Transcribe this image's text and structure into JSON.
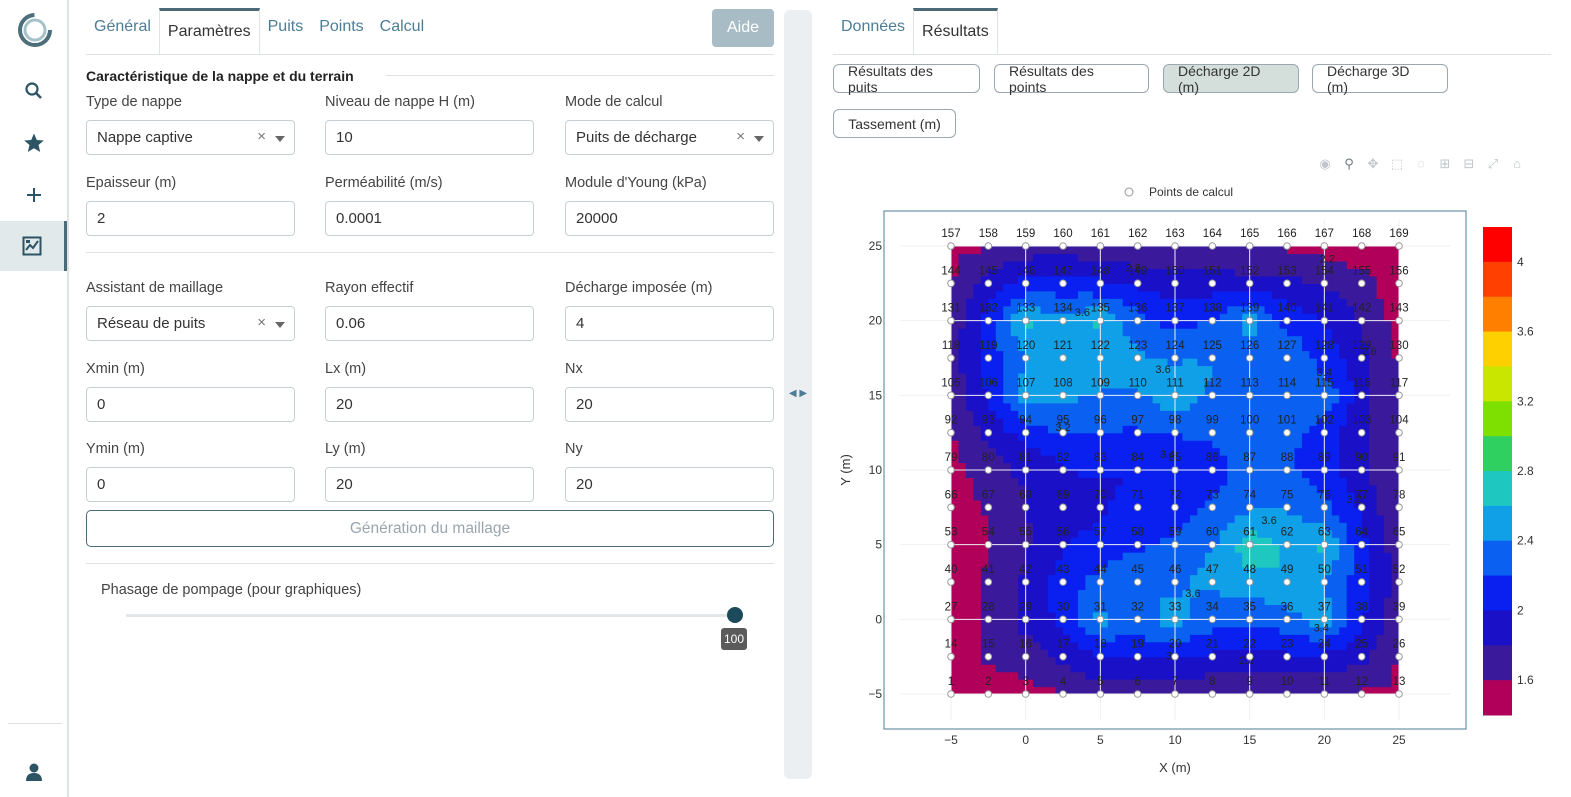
{
  "sidebar": {
    "items": [
      {
        "name": "search-icon"
      },
      {
        "name": "star-icon"
      },
      {
        "name": "plus-icon"
      },
      {
        "name": "chart-icon"
      }
    ]
  },
  "left_tabs": [
    "Général",
    "Paramètres",
    "Puits",
    "Points",
    "Calcul"
  ],
  "left_tabs_active": "Paramètres",
  "help_label": "Aide",
  "section_title": "Caractéristique de la nappe et du terrain",
  "fields": {
    "type_nappe": {
      "label": "Type de nappe",
      "value": "Nappe captive"
    },
    "niveau_nappe": {
      "label": "Niveau de nappe H (m)",
      "value": "10"
    },
    "mode_calcul": {
      "label": "Mode de calcul",
      "value": "Puits de décharge"
    },
    "epaisseur": {
      "label": "Epaisseur (m)",
      "value": "2"
    },
    "permeabilite": {
      "label": "Perméabilité (m/s)",
      "value": "0.0001"
    },
    "module_young": {
      "label": "Module d'Young (kPa)",
      "value": "20000"
    },
    "assistant": {
      "label": "Assistant de maillage",
      "value": "Réseau de puits"
    },
    "rayon": {
      "label": "Rayon effectif",
      "value": "0.06"
    },
    "decharge": {
      "label": "Décharge imposée (m)",
      "value": "4"
    },
    "xmin": {
      "label": "Xmin (m)",
      "value": "0"
    },
    "lx": {
      "label": "Lx (m)",
      "value": "20"
    },
    "nx": {
      "label": "Nx",
      "value": "20"
    },
    "ymin": {
      "label": "Ymin (m)",
      "value": "0"
    },
    "ly": {
      "label": "Ly (m)",
      "value": "20"
    },
    "ny": {
      "label": "Ny",
      "value": "20"
    }
  },
  "clear_symbol": "×",
  "generate_label": "Génération du maillage",
  "slider": {
    "label": "Phasage de pompage (pour graphiques)",
    "value": "100",
    "fraction": 1.0
  },
  "right_tabs": [
    "Données",
    "Résultats"
  ],
  "right_tabs_active": "Résultats",
  "result_buttons": [
    "Résultats des puits",
    "Résultats des points",
    "Décharge 2D (m)",
    "Décharge 3D (m)",
    "Tassement (m)"
  ],
  "result_active": "Décharge 2D (m)",
  "chart_data": {
    "type": "contour",
    "legend_label": "Points de calcul",
    "xlabel": "X (m)",
    "ylabel": "Y (m)",
    "xlim": [
      -5,
      25
    ],
    "ylim": [
      -5,
      25
    ],
    "xticks": [
      "−5",
      "0",
      "5",
      "10",
      "15",
      "20",
      "25"
    ],
    "yticks": [
      "−5",
      "0",
      "5",
      "10",
      "15",
      "20",
      "25"
    ],
    "grid_x": [
      -5,
      -2.5,
      0,
      2.5,
      5,
      7.5,
      10,
      12.5,
      15,
      17.5,
      20,
      22.5,
      25
    ],
    "grid_y": [
      -5,
      -2.5,
      0,
      2.5,
      5,
      7.5,
      10,
      12.5,
      15,
      17.5,
      20,
      22.5,
      25
    ],
    "wells": [
      [
        0,
        20
      ],
      [
        5,
        20
      ],
      [
        15,
        20
      ],
      [
        0,
        15
      ],
      [
        10,
        15
      ],
      [
        20,
        15
      ],
      [
        15,
        5
      ],
      [
        20,
        5
      ],
      [
        5,
        0
      ],
      [
        10,
        0
      ],
      [
        20,
        0
      ]
    ],
    "colorbar": {
      "ticks": [
        "4",
        "3.6",
        "3.2",
        "2.8",
        "2.4",
        "2",
        "1.6"
      ],
      "colors": [
        "#ff0000",
        "#ff4000",
        "#ff8000",
        "#ffd000",
        "#c8e600",
        "#7ee000",
        "#30d060",
        "#1ec8c0",
        "#0fa0e8",
        "#0a60f0",
        "#0a20f0",
        "#1a10c8",
        "#3a1a9a",
        "#b0005a"
      ]
    },
    "contour_labels": [
      {
        "text": "3.6",
        "x": 3.8,
        "y": 20.3
      },
      {
        "text": "3.6",
        "x": 9.2,
        "y": 16.5
      },
      {
        "text": "3.4",
        "x": 20,
        "y": 16.3
      },
      {
        "text": "3.2",
        "x": 2.5,
        "y": 12.6
      },
      {
        "text": "3.4",
        "x": 9.5,
        "y": 10.8
      },
      {
        "text": "3.2",
        "x": 22,
        "y": 7.8
      },
      {
        "text": "3.6",
        "x": 16.3,
        "y": 6.4
      },
      {
        "text": "3.6",
        "x": 11.2,
        "y": 1.5
      },
      {
        "text": "3.4",
        "x": 19.8,
        "y": -0.8
      },
      {
        "text": "3",
        "x": 9.6,
        "y": -2.7
      },
      {
        "text": "2.8",
        "x": 14.8,
        "y": -3.0
      },
      {
        "text": "2.8",
        "x": 7.2,
        "y": 23.3
      },
      {
        "text": "2.6",
        "x": 23.0,
        "y": 17.7
      },
      {
        "text": "2.2",
        "x": 20.2,
        "y": 23.9
      }
    ]
  }
}
